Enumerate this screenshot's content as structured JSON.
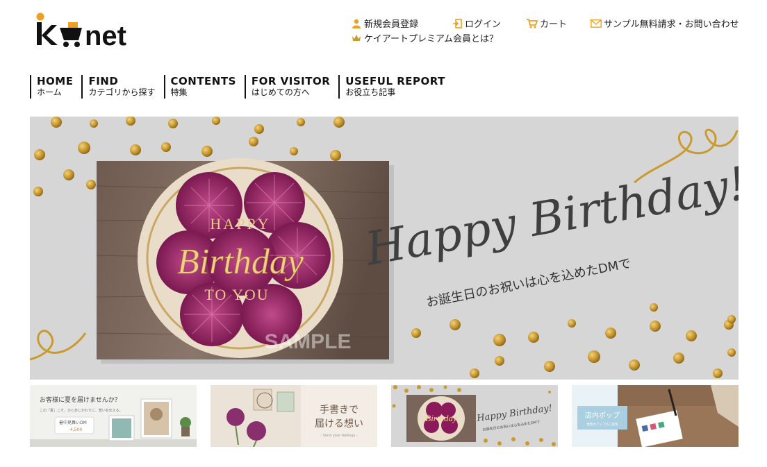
{
  "brand": {
    "logo_text": "kanet"
  },
  "top_links": {
    "register": "新規会員登録",
    "login": "ログイン",
    "cart": "カート",
    "contact": "サンプル無料請求・お問い合わせ",
    "premium": "ケイアートプレミアム会員とは？"
  },
  "nav": [
    {
      "en": "HOME",
      "jp": "ホーム"
    },
    {
      "en": "FIND",
      "jp": "カテゴリから探す"
    },
    {
      "en": "CONTENTS",
      "jp": "特集"
    },
    {
      "en": "FOR VISITOR",
      "jp": "はじめての方へ"
    },
    {
      "en": "USEFUL REPORT",
      "jp": "お役立ち記事"
    }
  ],
  "hero": {
    "card_happy": "HAPPY",
    "card_birthday": "Birthday",
    "card_to_you": "TO YOU",
    "script_title": "Happy Birthday!",
    "subtitle": "お誕生日のお祝いは心を込めたDMで",
    "watermark": "SAMPLE"
  },
  "thumbs": {
    "summer": {
      "line1": "お客様に夏を届けませんか？",
      "line2": "この「夏」こそ、ひとあじかわりに、想いを伝える。",
      "badge": "暑中見舞いDM",
      "price": "4,500"
    },
    "handwritten": {
      "line1": "手書きで",
      "line2": "届ける想い",
      "caption": "- Send your feelings -"
    },
    "birthday": {
      "card": "Birthday",
      "script": "Happy Birthday!",
      "subtitle": "お誕生日のお祝いは心を込めたDMで"
    },
    "pop": {
      "title": "店内ポップ",
      "subtitle": "集客力アップのご提案"
    }
  },
  "colors": {
    "accent_gold": "#c99a2e",
    "hero_bg": "#d6d6d6",
    "icon_orange": "#f0a020"
  }
}
